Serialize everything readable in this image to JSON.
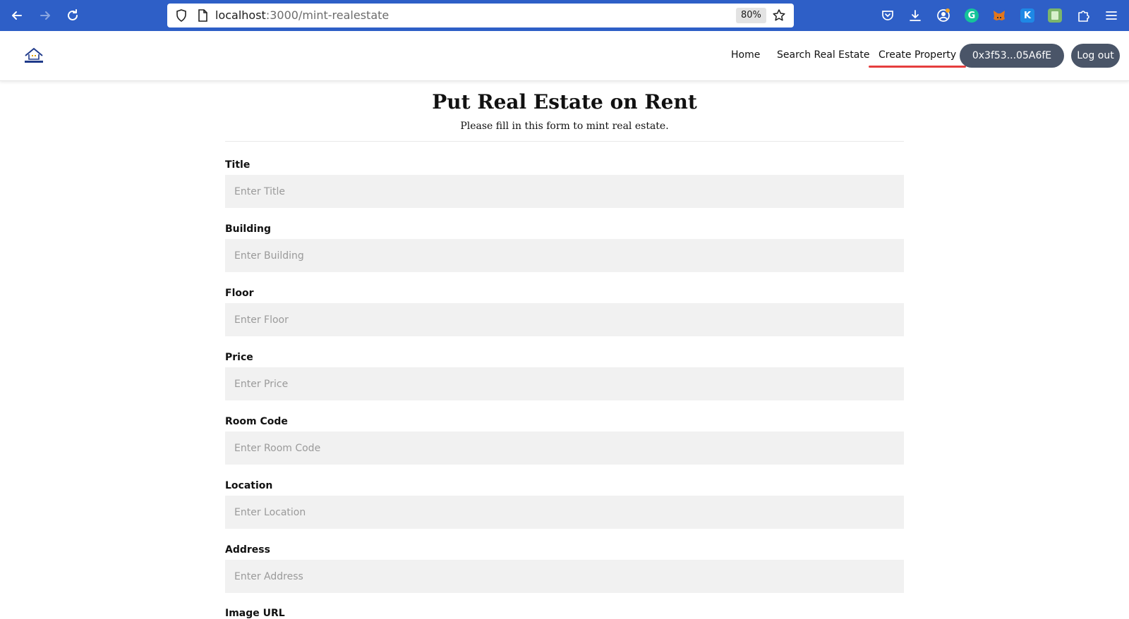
{
  "browser": {
    "url_host": "localhost",
    "url_path": ":3000/mint-realestate",
    "zoom": "80%"
  },
  "header": {
    "nav": [
      {
        "label": "Home"
      },
      {
        "label": "Search Real Estate"
      },
      {
        "label": "Create Property",
        "active": true
      }
    ],
    "wallet_label": "0x3f53...05A6fE",
    "logout_label": "Log out",
    "accent_color": "#e53e3e",
    "pill_color": "#4a5568"
  },
  "page": {
    "title": "Put Real Estate on Rent",
    "subtitle": "Please fill in this form to mint real estate."
  },
  "form": {
    "fields": [
      {
        "label": "Title",
        "placeholder": "Enter Title",
        "value": ""
      },
      {
        "label": "Building",
        "placeholder": "Enter Building",
        "value": ""
      },
      {
        "label": "Floor",
        "placeholder": "Enter Floor",
        "value": ""
      },
      {
        "label": "Price",
        "placeholder": "Enter Price",
        "value": ""
      },
      {
        "label": "Room Code",
        "placeholder": "Enter Room Code",
        "value": ""
      },
      {
        "label": "Location",
        "placeholder": "Enter Location",
        "value": ""
      },
      {
        "label": "Address",
        "placeholder": "Enter Address",
        "value": ""
      },
      {
        "label": "Image URL"
      }
    ]
  }
}
